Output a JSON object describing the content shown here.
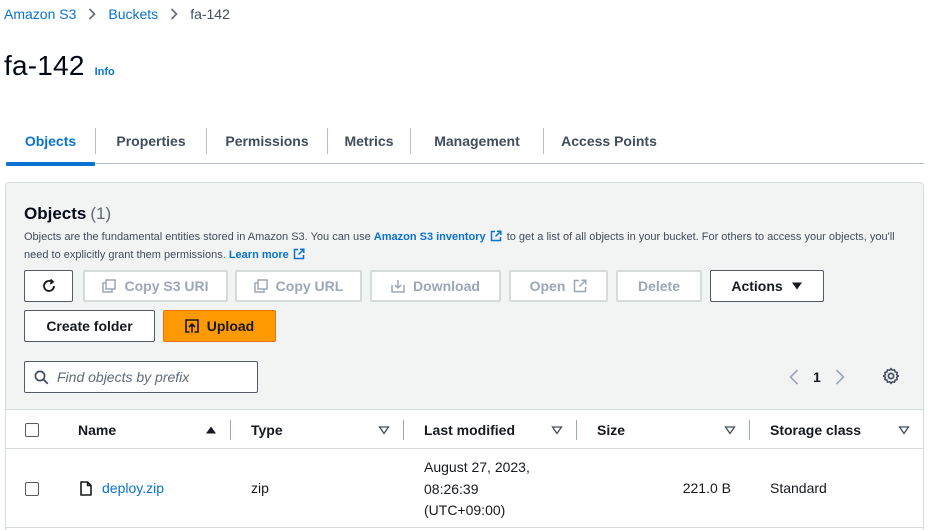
{
  "breadcrumb": {
    "items": [
      "Amazon S3",
      "Buckets",
      "fa-142"
    ]
  },
  "page": {
    "title": "fa-142",
    "info_label": "Info"
  },
  "tabs": [
    {
      "label": "Objects",
      "active": true
    },
    {
      "label": "Properties",
      "active": false
    },
    {
      "label": "Permissions",
      "active": false
    },
    {
      "label": "Metrics",
      "active": false
    },
    {
      "label": "Management",
      "active": false
    },
    {
      "label": "Access Points",
      "active": false
    }
  ],
  "objects": {
    "title": "Objects",
    "count": "(1)",
    "description_part1": "Objects are the fundamental entities stored in Amazon S3. You can use ",
    "inventory_link": "Amazon S3 inventory",
    "description_part2": " to get a list of all objects in your bucket. For others to access your objects, you'll need to explicitly grant them permissions. ",
    "learn_more": "Learn more"
  },
  "toolbar": {
    "copy_s3_uri": "Copy S3 URI",
    "copy_url": "Copy URL",
    "download": "Download",
    "open": "Open",
    "delete": "Delete",
    "actions": "Actions",
    "create_folder": "Create folder",
    "upload": "Upload"
  },
  "search": {
    "placeholder": "Find objects by prefix"
  },
  "pagination": {
    "current_page": "1"
  },
  "table": {
    "columns": [
      "Name",
      "Type",
      "Last modified",
      "Size",
      "Storage class"
    ],
    "rows": [
      {
        "name": "deploy.zip",
        "type": "zip",
        "last_modified_line1": "August 27, 2023,",
        "last_modified_line2": "08:26:39",
        "last_modified_line3": "(UTC+09:00)",
        "size": "221.0 B",
        "storage_class": "Standard"
      }
    ]
  },
  "colors": {
    "link_blue": "#0972d3",
    "primary_orange": "#ff9900",
    "header_gray": "#f2f3f3"
  }
}
